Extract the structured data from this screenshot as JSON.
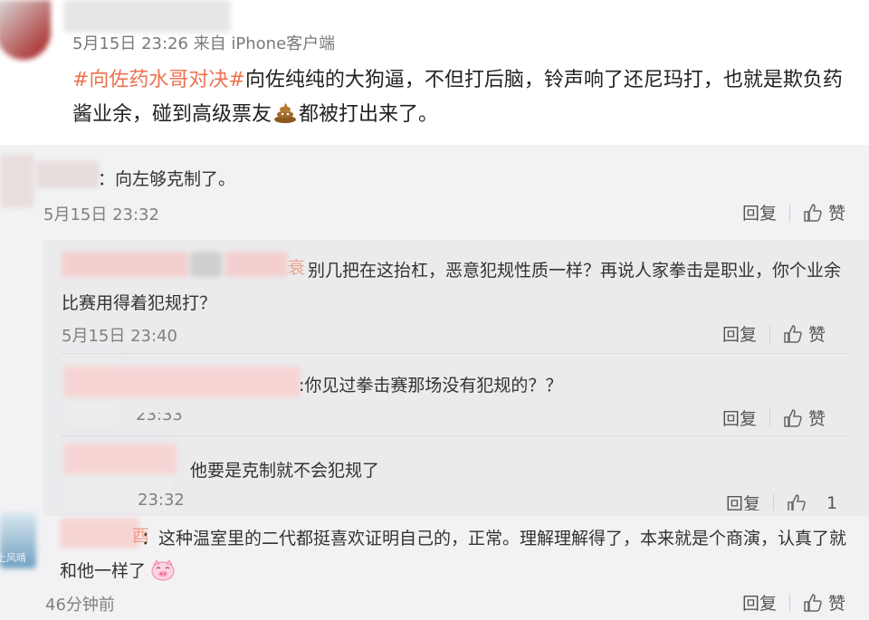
{
  "post": {
    "meta": "5月15日 23:26 来自 iPhone客户端",
    "hashtag": "#向佐药水哥对决#",
    "text_part1": "向佐纯纯的大狗逼，不但打后脑，铃声响了还尼玛打，也就是欺负药酱业余，碰到高级票友",
    "text_part2": "都被打出来了。",
    "emoji_icon": "poop-emoji-icon"
  },
  "comments": [
    {
      "text": "：向左够克制了。",
      "time": "5月15日 23:32",
      "reply": "回复",
      "like": "赞"
    },
    {
      "text": "别几把在这抬杠，恶意犯规性质一样？再说人家拳击是职业，你个业余比赛用得着犯规打？",
      "prefix": "衰",
      "time": "5月15日 23:40",
      "reply": "回复",
      "like": "赞"
    },
    {
      "text": ":你见过拳击赛那场没有犯规的？？",
      "time": "23:33",
      "reply": "回复",
      "like": "赞"
    },
    {
      "text": "他要是克制就不会犯规了",
      "time": "23:32",
      "reply": "回复",
      "like_count": "1"
    },
    {
      "text": "：这种温室里的二代都挺喜欢证明自己的，正常。理解理解得了，本来就是个商演，认真了就和他一样了",
      "prefix": "酉",
      "time": "46分钟前",
      "reply": "回复",
      "like": "赞",
      "emoji_icon": "pig-emoji-icon",
      "avatar_caption": "上风晴"
    }
  ],
  "colors": {
    "hashtag": "#eb7350",
    "panel_bg": "#f2f2f5",
    "subpanel_bg": "#ebebee"
  }
}
